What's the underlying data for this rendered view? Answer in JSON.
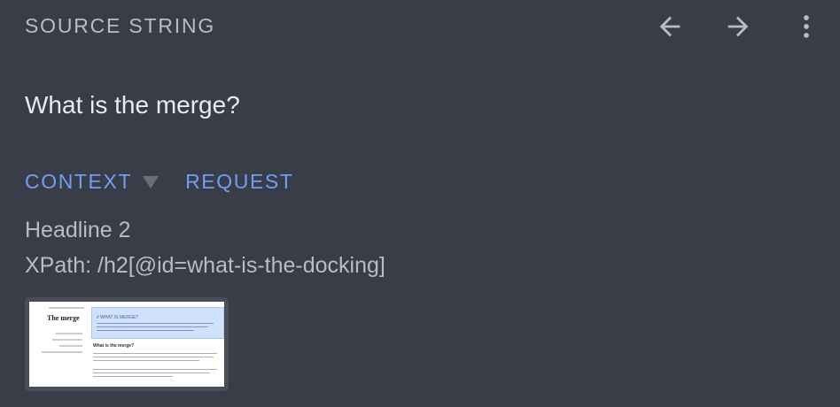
{
  "header": {
    "title": "SOURCE STRING",
    "back_icon": "arrow-left-icon",
    "forward_icon": "arrow-right-icon",
    "menu_icon": "more-vertical-icon"
  },
  "source": {
    "text": "What is the merge?"
  },
  "tabs": [
    {
      "label": "CONTEXT",
      "has_dropdown": true
    },
    {
      "label": "REQUEST"
    }
  ],
  "context": {
    "type_label": "Headline 2",
    "xpath": "XPath: /h2[@id=what-is-the-docking]"
  },
  "screenshot_thumb": {
    "page_title": "The merge",
    "highlight_title": "# WHAT IS MERGE?",
    "section_heading": "What is the merge?"
  },
  "colors": {
    "background": "#393d48",
    "accent": "#6f9ef5",
    "muted_text": "#b9bcc3",
    "primary_text": "#e9eaed"
  }
}
